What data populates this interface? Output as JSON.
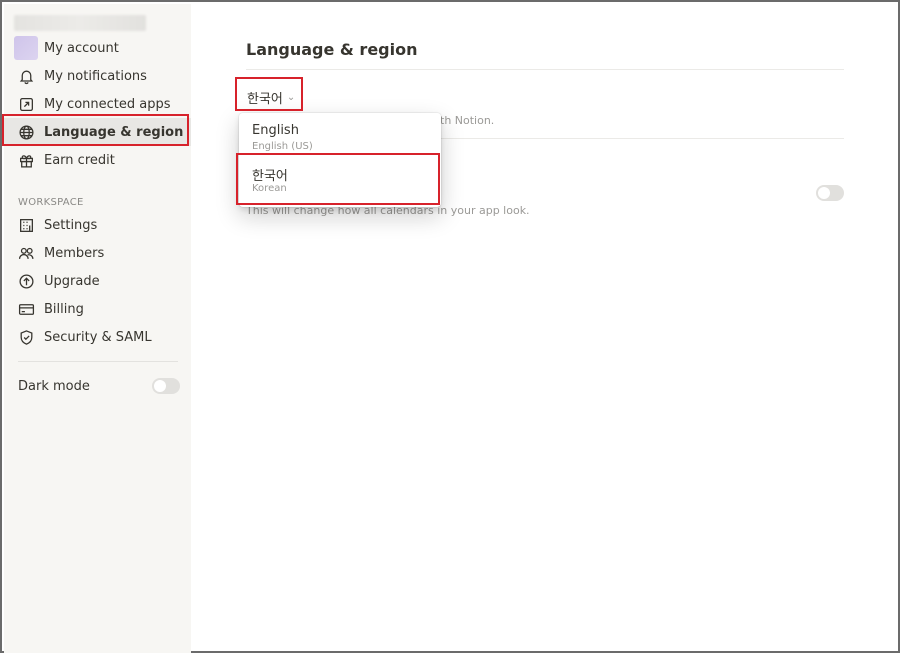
{
  "sidebar": {
    "items": [
      {
        "label": "My account"
      },
      {
        "label": "My notifications"
      },
      {
        "label": "My connected apps"
      },
      {
        "label": "Language & region"
      },
      {
        "label": "Earn credit"
      }
    ],
    "workspace_section": "WORKSPACE",
    "workspace_items": [
      {
        "label": "Settings"
      },
      {
        "label": "Members"
      },
      {
        "label": "Upgrade"
      },
      {
        "label": "Billing"
      },
      {
        "label": "Security & SAML"
      }
    ],
    "dark_mode_label": "Dark mode"
  },
  "main": {
    "title": "Language & region",
    "language_select_value": "한국어",
    "language_desc_visible": "th Notion.",
    "calendar_desc": "This will change how all calendars in your app look."
  },
  "dropdown": {
    "options": [
      {
        "label": "English",
        "sub": "English (US)"
      },
      {
        "label": "한국어",
        "sub": "Korean"
      }
    ]
  },
  "colors": {
    "highlight": "#d7222b",
    "sidebar_bg": "#f7f6f3",
    "active_bg": "#e8e7e4"
  }
}
